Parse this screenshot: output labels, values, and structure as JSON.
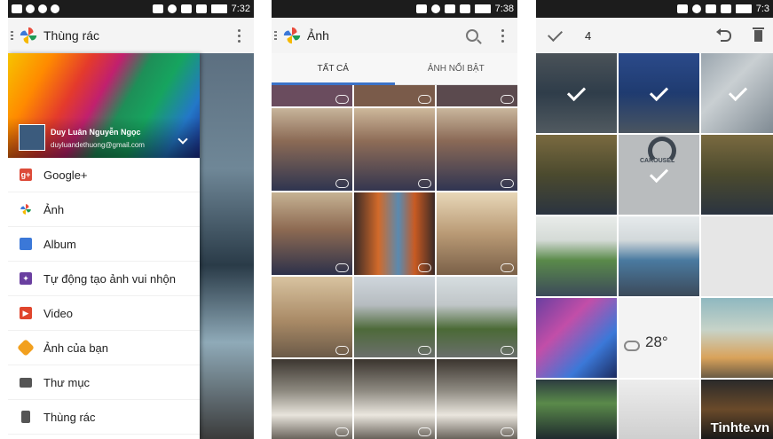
{
  "screens": {
    "left": {
      "status_time": "7:32",
      "title": "Thùng rác",
      "account_name": "Duy Luân Nguyễn Ngọc",
      "account_email": "duyluandethuong@gmail.com",
      "nav_items": [
        {
          "label": "Google+",
          "icon": "google-plus-icon",
          "color": "#dd4b39"
        },
        {
          "label": "Ảnh",
          "icon": "photos-pinwheel-icon",
          "color": "#4a89dc"
        },
        {
          "label": "Album",
          "icon": "album-icon",
          "color": "#3b78d8"
        },
        {
          "label": "Tự động tạo ảnh vui nhộn",
          "icon": "auto-awesome-icon",
          "color": "#6a3fa0"
        },
        {
          "label": "Video",
          "icon": "video-icon",
          "color": "#e0452c"
        },
        {
          "label": "Ảnh của bạn",
          "icon": "tag-icon",
          "color": "#f2a01e"
        },
        {
          "label": "Thư mục",
          "icon": "folder-icon",
          "color": "#555555"
        },
        {
          "label": "Thùng rác",
          "icon": "trash-icon",
          "color": "#555555"
        }
      ]
    },
    "middle": {
      "status_time": "7:38",
      "title": "Ảnh",
      "tabs": [
        {
          "label": "TẤT CẢ",
          "active": true
        },
        {
          "label": "ẢNH NỔI BẬT",
          "active": false
        }
      ]
    },
    "right": {
      "status_time": "7:3",
      "selected_count": "4",
      "carousel_label": "CAROUSEL",
      "weather_temp": "28°",
      "watermark": "Tinhte.vn"
    }
  },
  "colors": {
    "accent": "#3b72c8",
    "statusbar": "#1c1c1c",
    "appbar": "#f4f4f4"
  }
}
